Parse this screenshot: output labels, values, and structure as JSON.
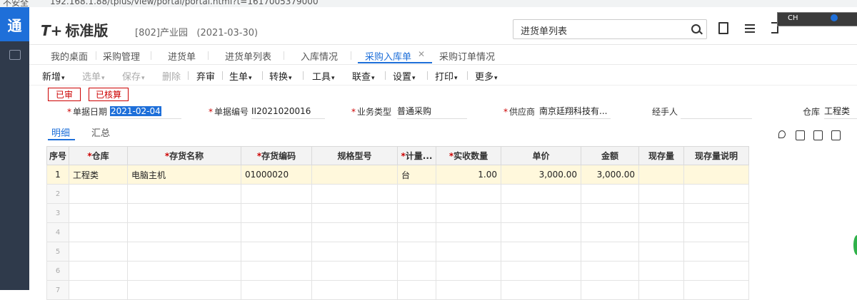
{
  "browser": {
    "security": "不安全",
    "url": "192.168.1.88/tplus/view/portal/portal.html?t=1617005379000"
  },
  "app": {
    "logo": "通",
    "brand_mark": "T+",
    "brand_name": "标准版",
    "org": "[802]产业园",
    "date": "(2021-03-30)"
  },
  "search": {
    "value": "进货单列表"
  },
  "ime": {
    "label": "CH"
  },
  "tabs": [
    {
      "label": "我的桌面"
    },
    {
      "label": "采购管理"
    },
    {
      "label": "进货单"
    },
    {
      "label": "进货单列表"
    },
    {
      "label": "入库情况"
    },
    {
      "label": "采购入库单",
      "active": true
    },
    {
      "label": "采购订单情况"
    }
  ],
  "toolbar": {
    "items": [
      {
        "label": "新增",
        "caret": "▾"
      },
      {
        "label": "选单",
        "caret": "▾",
        "disabled": true
      },
      {
        "label": "保存",
        "caret": "▾",
        "disabled": true
      },
      {
        "label": "删除",
        "caret": "",
        "disabled": true
      },
      {
        "label": "弃审",
        "caret": ""
      },
      {
        "label": "生单",
        "caret": "▾"
      },
      {
        "label": "转换",
        "caret": "▾"
      },
      {
        "label": "工具",
        "caret": "▾"
      },
      {
        "label": "联查",
        "caret": "▾"
      },
      {
        "label": "设置",
        "caret": "▾"
      },
      {
        "label": "打印",
        "caret": "▾"
      },
      {
        "label": "更多",
        "caret": "▾"
      }
    ]
  },
  "stamps": {
    "audited": "已审",
    "costed": "已核算"
  },
  "form": {
    "doc_date": {
      "label": "单据日期",
      "value": "2021-02-04"
    },
    "doc_no": {
      "label": "单据编号",
      "value": "II2021020016"
    },
    "biz_type": {
      "label": "业务类型",
      "value": "普通采购"
    },
    "supplier": {
      "label": "供应商",
      "value": "南京廷翔科技有..."
    },
    "handler": {
      "label": "经手人",
      "value": ""
    },
    "warehouse": {
      "label": "仓库",
      "value": "工程类"
    }
  },
  "subtabs": {
    "detail": "明细",
    "summary": "汇总"
  },
  "grid": {
    "headers": {
      "idx": "序号",
      "warehouse": "仓库",
      "name": "存货名称",
      "code": "存货编码",
      "spec": "规格型号",
      "unit": "计量...",
      "qty": "实收数量",
      "price": "单价",
      "amount": "金额",
      "stock": "现存量",
      "stock_note": "现存量说明"
    },
    "rows": [
      {
        "idx": "1",
        "warehouse": "工程类",
        "name": "电脑主机",
        "code": "01000020",
        "spec": "",
        "unit": "台",
        "qty": "1.00",
        "price": "3,000.00",
        "amount": "3,000.00",
        "stock": "",
        "stock_note": ""
      },
      {
        "idx": "2"
      },
      {
        "idx": "3"
      },
      {
        "idx": "4"
      },
      {
        "idx": "5"
      },
      {
        "idx": "6"
      },
      {
        "idx": "7"
      }
    ]
  }
}
